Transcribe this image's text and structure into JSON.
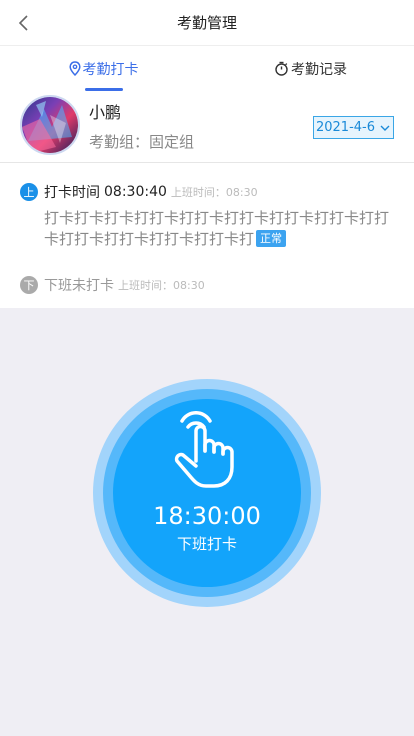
{
  "header": {
    "title": "考勤管理"
  },
  "tabs": [
    {
      "label": "考勤打卡",
      "active": true
    },
    {
      "label": "考勤记录",
      "active": false
    }
  ],
  "profile": {
    "name": "小鹏",
    "group_label": "考勤组：",
    "group_value": "固定组",
    "date": "2021-4-6"
  },
  "records": {
    "on": {
      "badge": "上",
      "label": "打卡时间",
      "time": "08:30:40",
      "scheduled_label": "上班时间：",
      "scheduled_time": "08:30",
      "note": "打卡打卡打卡打打卡打打卡打打卡打打卡打打卡打打卡打打卡打打卡打打卡打打卡打",
      "status": "正常"
    },
    "off": {
      "badge": "下",
      "label": "下班未打卡",
      "scheduled_label": "上班时间：",
      "scheduled_time": "08:30"
    }
  },
  "clock": {
    "time": "18:30:00",
    "label": "下班打卡"
  },
  "colors": {
    "accent": "#3b6ee8",
    "button": "#13a4fb",
    "ring_outer": "#a2d4fb",
    "ring_mid": "#55b8fa",
    "status_bg": "#3ca3f0",
    "background": "#efeef4"
  },
  "icons": [
    "back-icon",
    "location-pin-icon",
    "stopwatch-icon",
    "chevron-down-icon",
    "hand-tap-icon"
  ]
}
